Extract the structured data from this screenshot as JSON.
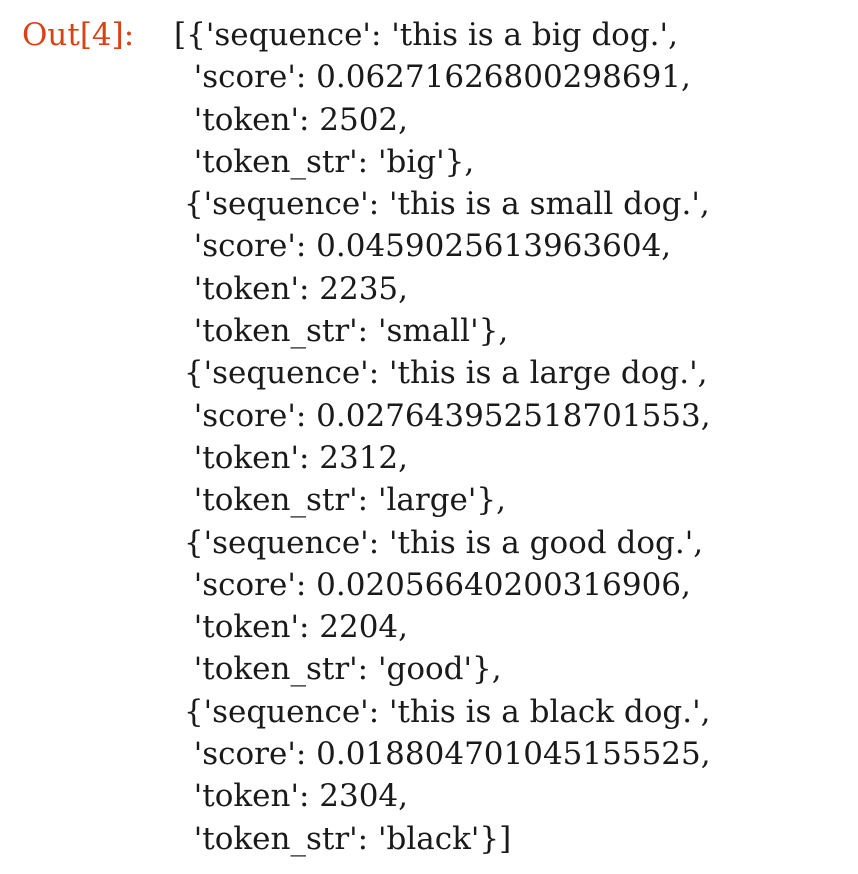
{
  "cell": {
    "prompt": "Out[4]:",
    "lines": [
      "[{'sequence': 'this is a big dog.',",
      "  'score': 0.06271626800298691,",
      "  'token': 2502,",
      "  'token_str': 'big'},",
      " {'sequence': 'this is a small dog.',",
      "  'score': 0.0459025613963604,",
      "  'token': 2235,",
      "  'token_str': 'small'},",
      " {'sequence': 'this is a large dog.',",
      "  'score': 0.027643952518701553,",
      "  'token': 2312,",
      "  'token_str': 'large'},",
      " {'sequence': 'this is a good dog.',",
      "  'score': 0.02056640200316906,",
      "  'token': 2204,",
      "  'token_str': 'good'},",
      " {'sequence': 'this is a black dog.',",
      "  'score': 0.018804701045155525,",
      "  'token': 2304,",
      "  'token_str': 'black'}]"
    ]
  },
  "colors": {
    "prompt": "#d84315",
    "text": "#1a1a1a",
    "background": "#ffffff"
  }
}
